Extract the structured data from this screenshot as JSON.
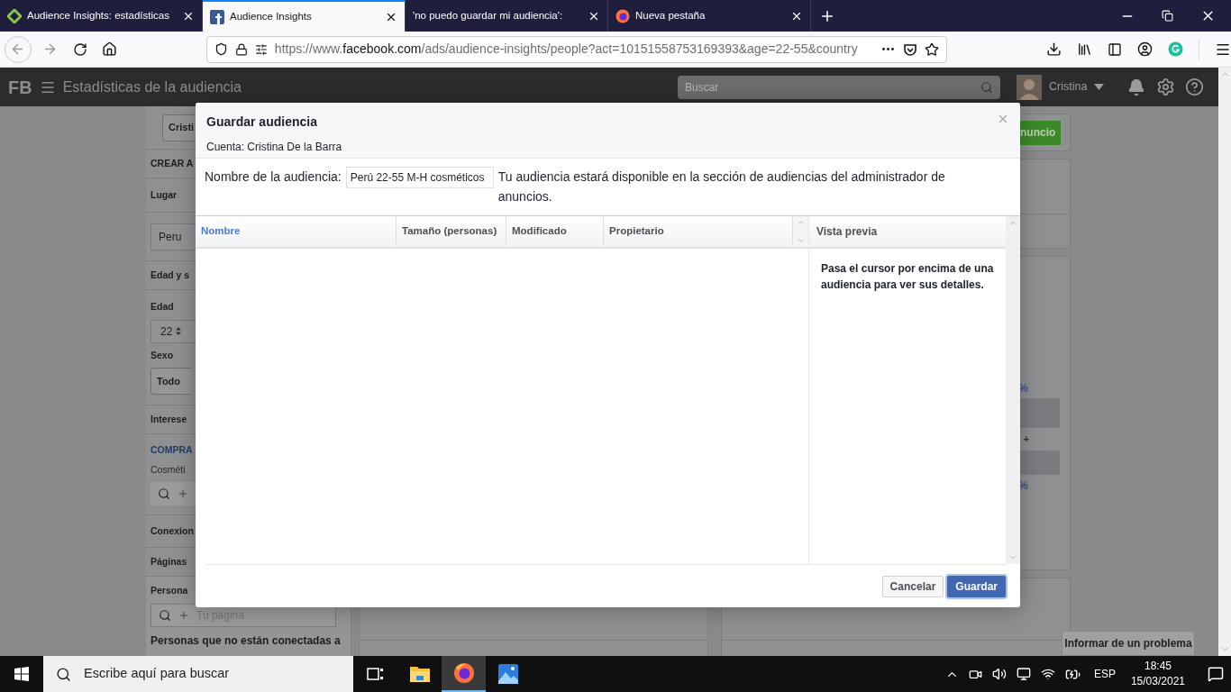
{
  "browser": {
    "tabs": [
      {
        "kind": "diamond",
        "title": "Audience Insights: estadísticas",
        "selected": false
      },
      {
        "kind": "square",
        "title": "Audience Insights",
        "selected": true
      },
      {
        "kind": "none",
        "title": "'no puedo guardar mi audiencia':",
        "selected": false
      },
      {
        "kind": "globe",
        "title": "Nueva pestaña",
        "selected": false
      }
    ],
    "address": {
      "scheme": "https://www.",
      "domain": "facebook.com",
      "path": "/ads/audience-insights/people?act=10151558753169393&age=22-55&country"
    }
  },
  "app": {
    "logo": "FB",
    "title": "Estadísticas de la audiencia",
    "search": {
      "placeholder": "Buscar"
    },
    "user": {
      "name": "Cristina"
    }
  },
  "sidebar": {
    "sections": [
      {
        "items": [
          {
            "kind": "button",
            "text": "Cristi"
          }
        ]
      },
      {
        "items": [
          {
            "kind": "heading",
            "text": "CREAR A"
          }
        ]
      },
      {
        "items": [
          {
            "kind": "heading",
            "text": "Lugar"
          }
        ]
      },
      {
        "items": [
          {
            "kind": "field",
            "text": "Peru"
          }
        ]
      },
      {
        "items": [
          {
            "kind": "heading",
            "text": "Edad y s"
          }
        ]
      },
      {
        "items": [
          {
            "kind": "heading",
            "text": "Edad"
          },
          {
            "kind": "select",
            "text": "22"
          },
          {
            "kind": "heading",
            "text": "Sexo"
          },
          {
            "kind": "button",
            "text": "Todo"
          }
        ]
      },
      {
        "items": [
          {
            "kind": "heading",
            "text": "Interese"
          }
        ]
      },
      {
        "items": [
          {
            "kind": "accent",
            "text": "COMPRA"
          },
          {
            "kind": "text",
            "text": "Cosméti"
          },
          {
            "kind": "search"
          }
        ]
      },
      {
        "items": [
          {
            "kind": "heading",
            "text": "Conexion"
          }
        ]
      },
      {
        "items": [
          {
            "kind": "heading",
            "text": "Páginas"
          }
        ]
      },
      {
        "items": [
          {
            "kind": "heading",
            "text": "Persona"
          },
          {
            "kind": "search",
            "placeholder": "Tu página"
          },
          {
            "kind": "heading",
            "text": "Personas que no están conectadas a"
          }
        ]
      }
    ]
  },
  "main": {
    "action_button": "nuncio",
    "marks": [
      "%",
      "+",
      "%"
    ]
  },
  "dialog": {
    "title": "Guardar audiencia",
    "subtitle": "Cuenta: Cristina De la Barra",
    "name_label": "Nombre de la audiencia:",
    "name_value": "Perú 22-55 M-H cosméticos",
    "hint": "Tu audiencia estará disponible en la sección de audiencias del administrador de anuncios.",
    "table": {
      "columns": [
        {
          "label": "Nombre",
          "selected": true
        },
        {
          "label": "Tamaño (personas)",
          "selected": false
        },
        {
          "label": "Modificado",
          "selected": false
        },
        {
          "label": "Propietario",
          "selected": false
        }
      ]
    },
    "preview": {
      "title": "Vista previa",
      "text": "Pasa el cursor por encima de una audiencia para ver sus detalles."
    },
    "buttons": [
      {
        "label": "Cancelar",
        "kind": "secondary"
      },
      {
        "label": "Guardar",
        "kind": "primary"
      }
    ]
  },
  "report_button": "Informar de un problema",
  "taskbar": {
    "search": {
      "placeholder": "Escribe aquí para buscar"
    },
    "apps": [
      {
        "kind": "task_view",
        "selected": false
      },
      {
        "kind": "folder",
        "selected": false
      },
      {
        "kind": "browser",
        "selected": true
      },
      {
        "kind": "photos",
        "selected": false
      }
    ],
    "language": "ESP",
    "time": "18:45",
    "date": "15/03/2021"
  }
}
